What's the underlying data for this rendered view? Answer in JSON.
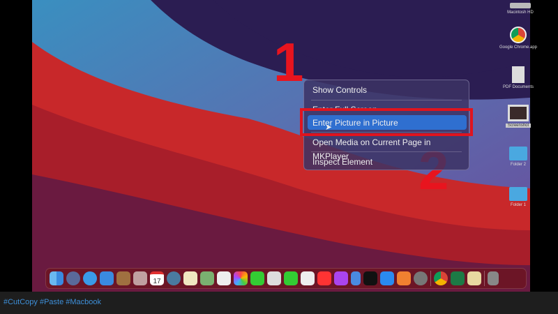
{
  "context_menu": {
    "items": [
      "Show Controls",
      "Enter Full Screen",
      "Enter Picture in Picture",
      "Open Media on Current Page in MKPlayer",
      "Inspect Element"
    ],
    "highlighted": "Enter Picture in Picture"
  },
  "annotations": {
    "step1": "1",
    "step2": "2"
  },
  "desktop_icons": [
    "Macintosh HD",
    "Google Chrome.app",
    "PDF Documents",
    "Screenshot",
    "Folder 2",
    "Folder 1"
  ],
  "dock": {
    "calendar_day": "17",
    "apps": [
      "Finder",
      "Launchpad",
      "Safari",
      "Mail",
      "Contacts",
      "Photos Booth",
      "Calendar",
      "System",
      "Notes",
      "Maps",
      "Reminders",
      "Photos",
      "Messages",
      "TextEdit",
      "FaceTime",
      "Numbers",
      "Music",
      "Podcasts",
      "Keynote",
      "Apple TV",
      "App Store",
      "Books",
      "System Preferences",
      "Chrome",
      "Excel",
      "Preview",
      "Trash"
    ]
  },
  "footer": {
    "hashtags": "#CutCopy #Paste #Macbook"
  },
  "colors": {
    "highlight": "#2f6fd0",
    "annotation": "#e0141e"
  }
}
